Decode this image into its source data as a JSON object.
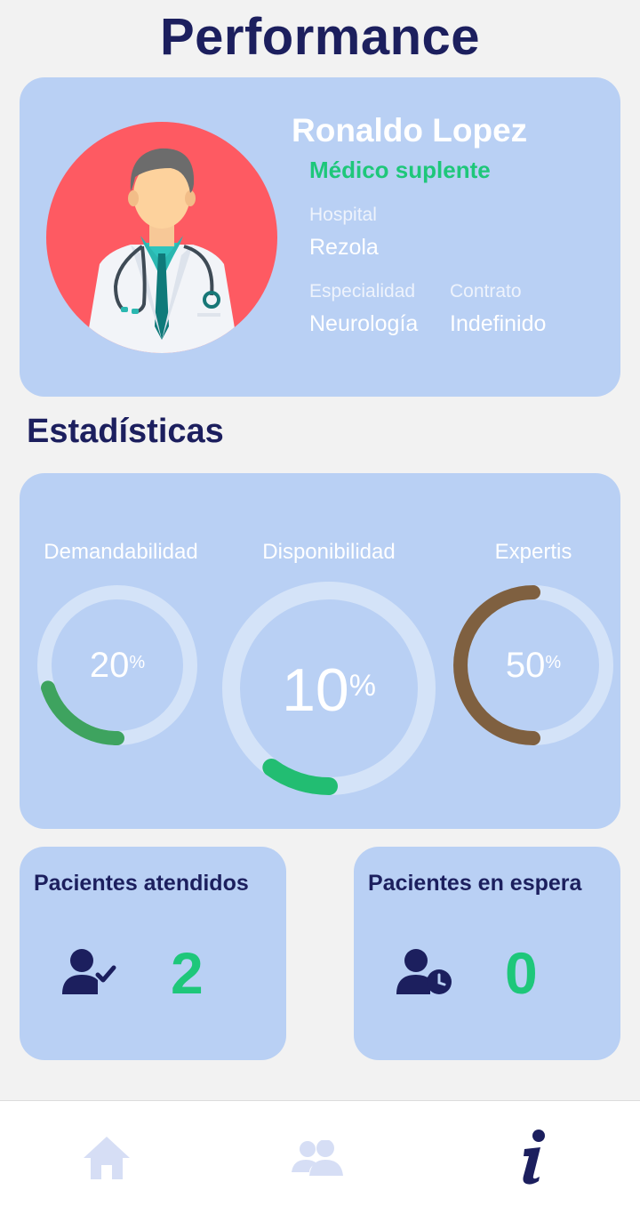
{
  "header": {
    "title": "Performance"
  },
  "profile": {
    "name": "Ronaldo Lopez",
    "role": "Médico suplente",
    "hospital_label": "Hospital",
    "hospital_value": "Rezola",
    "specialty_label": "Especialidad",
    "specialty_value": "Neurología",
    "contract_label": "Contrato",
    "contract_value": "Indefinido",
    "avatar_icon": "doctor-avatar"
  },
  "stats": {
    "title": "Estadísticas",
    "gauges": [
      {
        "label": "Demandabilidad",
        "value": "20",
        "unit": "%",
        "fraction": 0.2,
        "color": "#3ea35f"
      },
      {
        "label": "Disponibilidad",
        "value": "10",
        "unit": "%",
        "fraction": 0.1,
        "color": "#22bd72"
      },
      {
        "label": "Expertis",
        "value": "50",
        "unit": "%",
        "fraction": 0.5,
        "color": "#7f6040"
      }
    ]
  },
  "patients": {
    "attended_label": "Pacientes atendidos",
    "attended_count": "2",
    "attended_icon": "user-check-icon",
    "waiting_label": "Pacientes en espera",
    "waiting_count": "0",
    "waiting_icon": "user-clock-icon"
  },
  "nav": {
    "items": [
      {
        "icon": "home-icon",
        "active": false
      },
      {
        "icon": "users-icon",
        "active": false
      },
      {
        "icon": "info-icon",
        "active": true
      }
    ]
  },
  "colors": {
    "primary": "#1c1f5e",
    "card": "#b9d0f4",
    "accent_green": "#1ec77a",
    "avatar_bg": "#fe5a62",
    "nav_inactive": "#d6def5"
  }
}
